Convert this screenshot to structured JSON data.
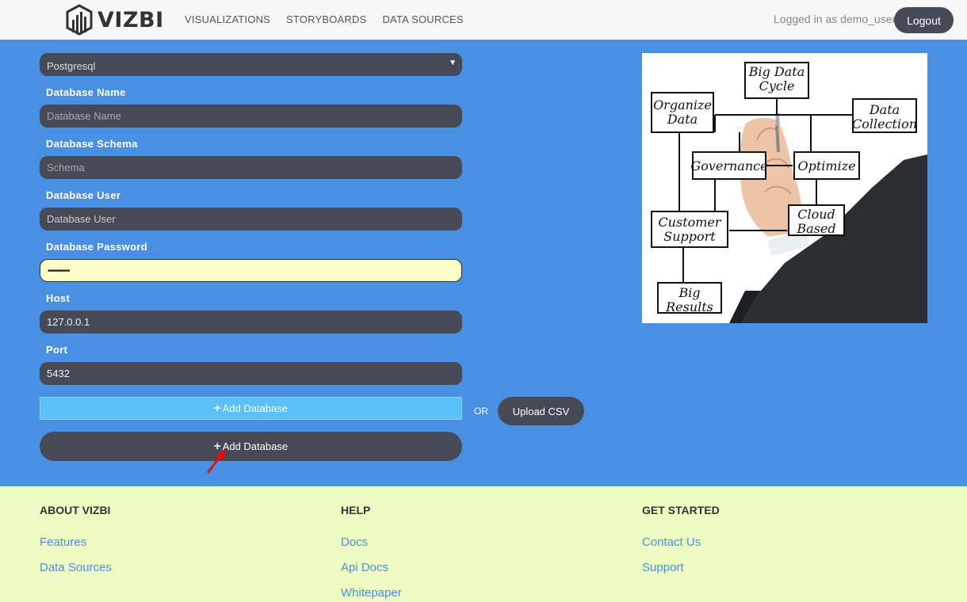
{
  "header": {
    "brand": "VIZBI",
    "nav": [
      "VISUALIZATIONS",
      "STORYBOARDS",
      "DATA SOURCES"
    ],
    "logged_in": "Logged in as demo_user",
    "logout_label": "Logout"
  },
  "form": {
    "db_type": "Postgresql",
    "db_name_label": "Database Name",
    "db_name_placeholder": "Database Name",
    "schema_label": "Database Schema",
    "schema_placeholder": "Schema",
    "user_label": "Database User",
    "user_placeholder": "Database User",
    "password_label": "Database Password",
    "password_value": "•••••••••••",
    "host_label": "Host",
    "host_value": "127.0.0.1",
    "port_label": "Port",
    "port_value": "5432",
    "add_database_label": "Add Database",
    "or_label": "OR",
    "upload_csv_label": "Upload CSV",
    "add_database_label_2": "Add Database"
  },
  "diagram": {
    "nodes": [
      "Big Data Cycle",
      "Organize Data",
      "Data Collection",
      "Governance",
      "Optimize",
      "Customer Support",
      "Cloud Based",
      "Big Results"
    ]
  },
  "footer": {
    "about_title": "ABOUT VIZBI",
    "about_links": [
      "Features",
      "Data Sources"
    ],
    "help_title": "HELP",
    "help_links": [
      "Docs",
      "Api Docs",
      "Whitepaper"
    ],
    "start_title": "GET STARTED",
    "start_links": [
      "Contact Us",
      "Support"
    ]
  },
  "colors": {
    "page_bg": "#4a90e2",
    "field_bg": "#454a56",
    "password_bg": "#fbfcc7",
    "add_button_bg": "#5bc0f8",
    "footer_bg": "#eefbc2",
    "link": "#4a90e2"
  }
}
